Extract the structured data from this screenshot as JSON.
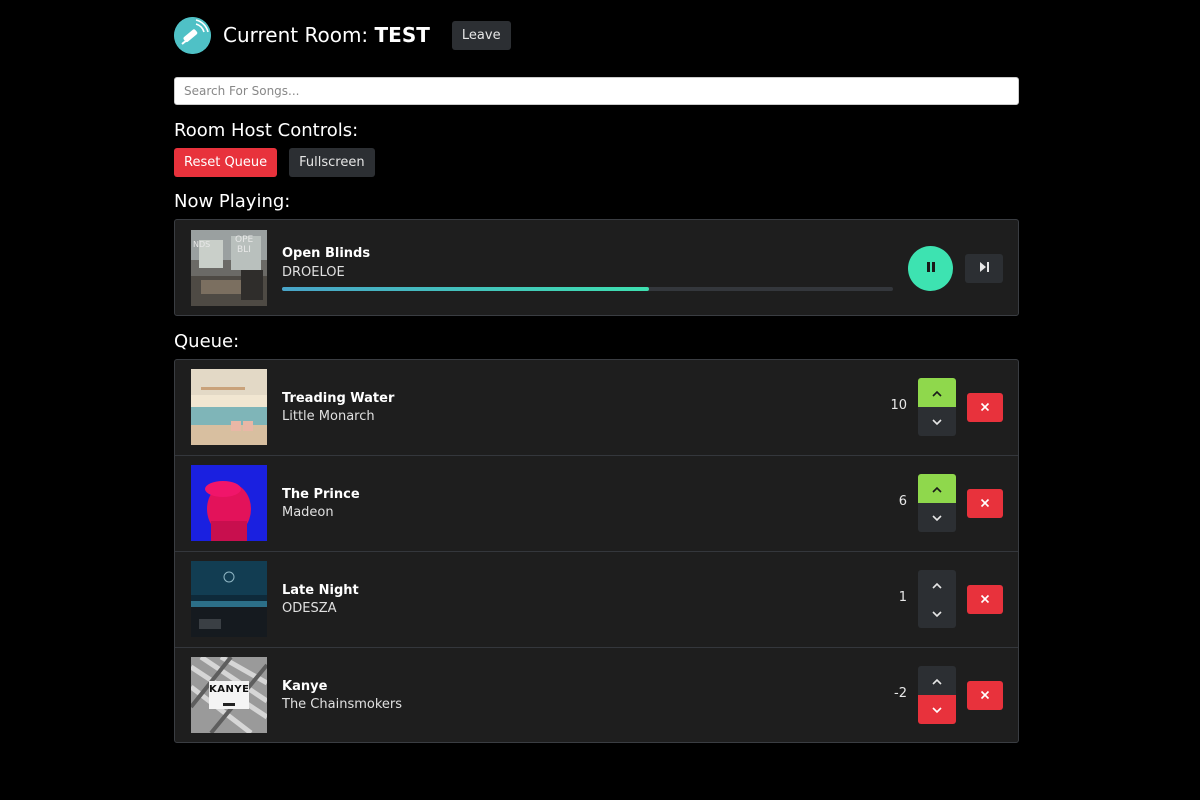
{
  "header": {
    "title_prefix": "Current Room: ",
    "room_name": "TEST",
    "leave_label": "Leave"
  },
  "search": {
    "placeholder": "Search For Songs..."
  },
  "host_controls": {
    "heading": "Room Host Controls:",
    "reset_label": "Reset Queue",
    "fullscreen_label": "Fullscreen"
  },
  "now_playing": {
    "heading": "Now Playing:",
    "title": "Open Blinds",
    "artist": "DROELOE",
    "progress": 0.6,
    "state": "playing",
    "pause_icon": "pause-icon",
    "skip_icon": "skip-next-icon"
  },
  "queue": {
    "heading": "Queue:",
    "items": [
      {
        "title": "Treading Water",
        "artist": "Little Monarch",
        "votes": "10",
        "vote_state": "up"
      },
      {
        "title": "The Prince",
        "artist": "Madeon",
        "votes": "6",
        "vote_state": "up"
      },
      {
        "title": "Late Night",
        "artist": "ODESZA",
        "votes": "1",
        "vote_state": "none"
      },
      {
        "title": "Kanye",
        "artist": "The Chainsmokers",
        "votes": "-2",
        "vote_state": "down"
      }
    ]
  },
  "colors": {
    "accent": "#3de3b1",
    "danger": "#e8323c",
    "upvote": "#8fd84c",
    "panel": "#1e1e1e"
  }
}
